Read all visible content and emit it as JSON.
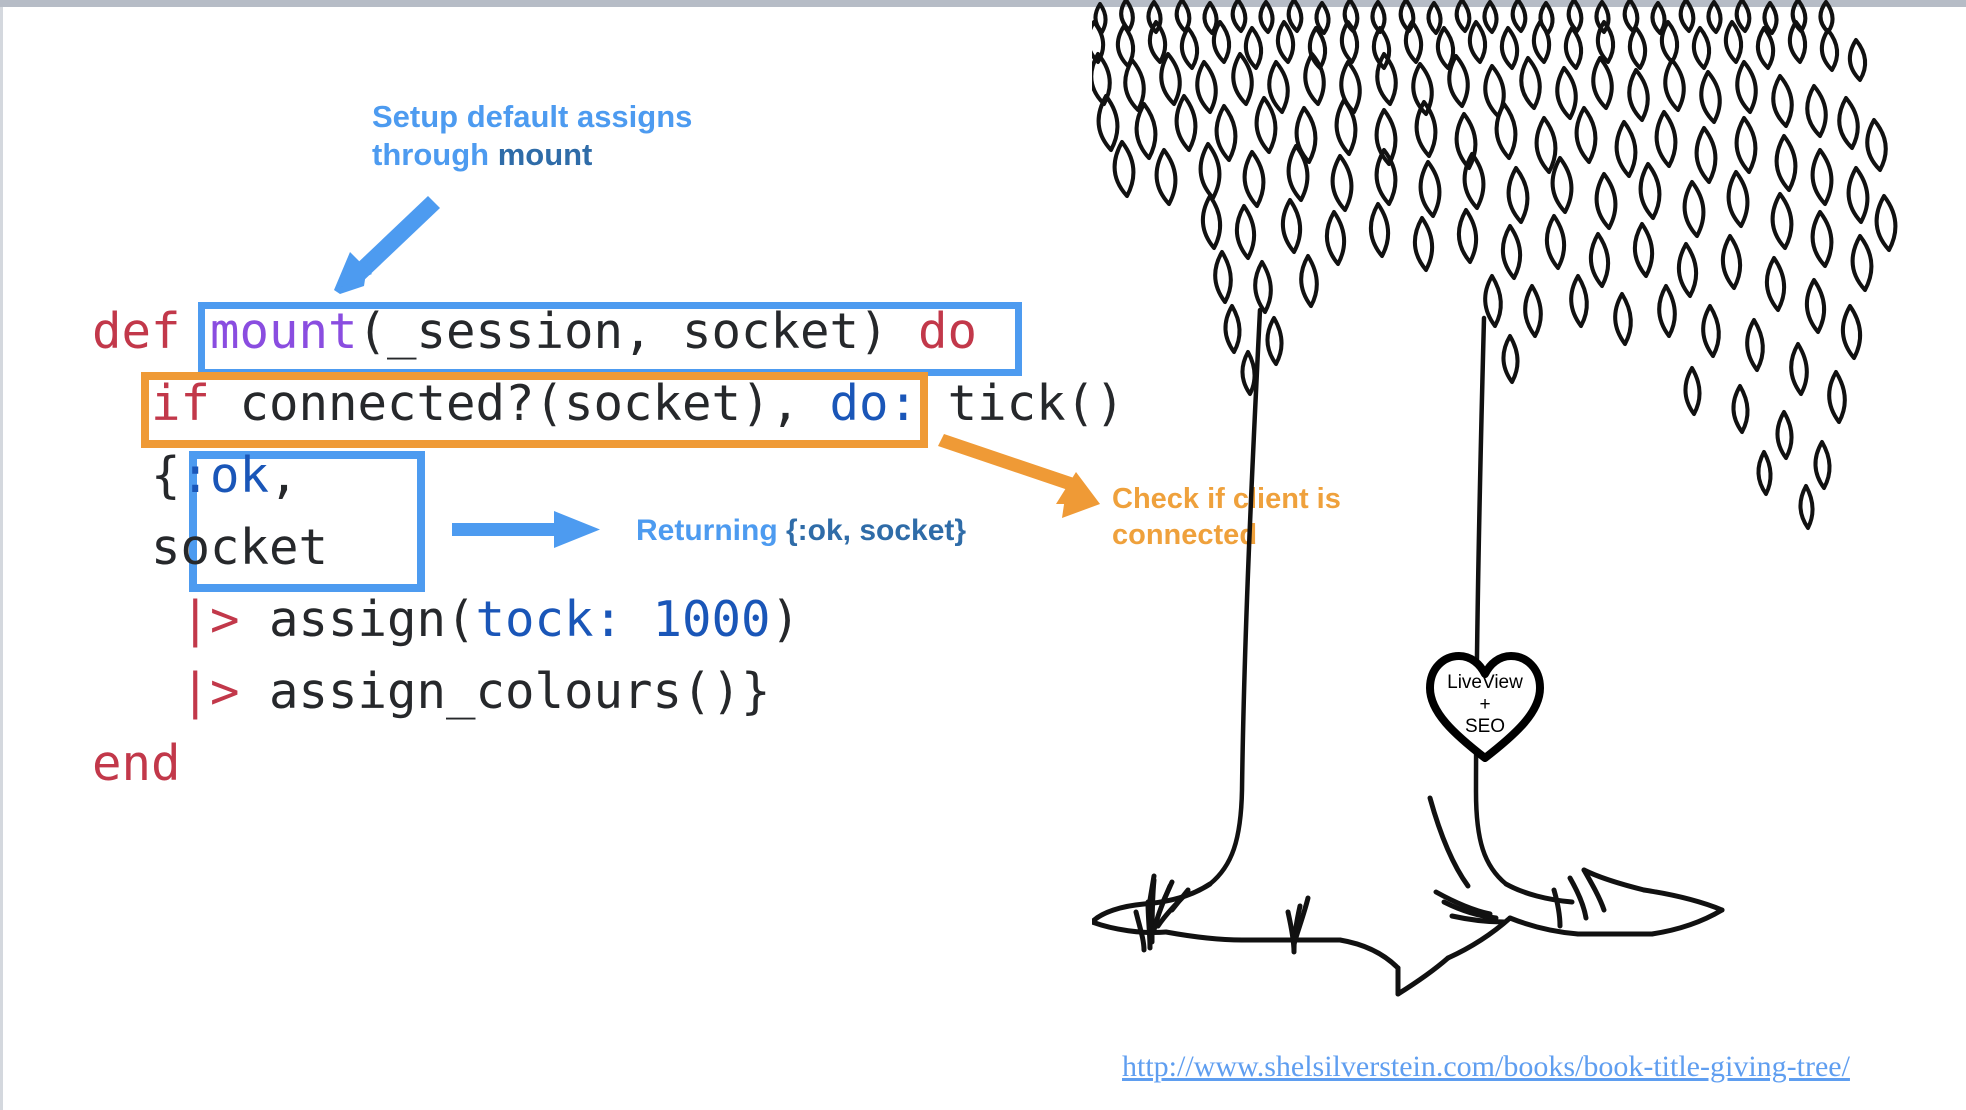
{
  "slide": {
    "background_color": "#ffffff"
  },
  "code": {
    "language": "elixir",
    "font": "monospace",
    "lines": [
      {
        "id": "line-def",
        "tokens": [
          {
            "text": "def ",
            "style": "red"
          },
          {
            "text": "mount",
            "style": "purple"
          },
          {
            "text": "(_session, socket) ",
            "style": "plain"
          },
          {
            "text": "do",
            "style": "red"
          }
        ]
      },
      {
        "id": "line-if",
        "tokens": [
          {
            "text": "  ",
            "style": "plain"
          },
          {
            "text": "if",
            "style": "red"
          },
          {
            "text": " connected?(socket), ",
            "style": "plain"
          },
          {
            "text": "do:",
            "style": "blue"
          },
          {
            "text": " tick()",
            "style": "plain"
          }
        ]
      },
      {
        "id": "line-ok",
        "tokens": [
          {
            "text": "  {",
            "style": "plain"
          },
          {
            "text": ":ok",
            "style": "blue"
          },
          {
            "text": ",",
            "style": "plain"
          }
        ]
      },
      {
        "id": "line-socket",
        "tokens": [
          {
            "text": "  socket",
            "style": "plain"
          }
        ]
      },
      {
        "id": "line-assign-tock",
        "tokens": [
          {
            "text": "   ",
            "style": "plain"
          },
          {
            "text": "|>",
            "style": "red"
          },
          {
            "text": " assign(",
            "style": "plain"
          },
          {
            "text": "tock: 1000",
            "style": "blue"
          },
          {
            "text": ")",
            "style": "plain"
          }
        ]
      },
      {
        "id": "line-assign-colours",
        "tokens": [
          {
            "text": "   ",
            "style": "plain"
          },
          {
            "text": "|>",
            "style": "red"
          },
          {
            "text": " assign_colours()}",
            "style": "plain"
          }
        ]
      },
      {
        "id": "line-end",
        "tokens": [
          {
            "text": "end",
            "style": "red"
          }
        ]
      }
    ]
  },
  "annotations": {
    "mount": {
      "text_plain": "Setup default assigns\nthrough ",
      "text_keyword": "mount",
      "color": "#4d9bf0",
      "keyword_color": "#2f6ca8"
    },
    "returning": {
      "text_plain": "Returning ",
      "text_keyword": "{:ok, socket}",
      "color": "#4d9bf0",
      "keyword_color": "#2f6ca8"
    },
    "connected": {
      "text": "Check if client is connected",
      "color": "#efa13c"
    }
  },
  "highlight_boxes": [
    {
      "id": "box-mount",
      "target": "mount(_session, socket)",
      "color": "#4d9bf0"
    },
    {
      "id": "box-if",
      "target": "if connected?(socket),",
      "color": "#ef9a36"
    },
    {
      "id": "box-ok",
      "target": "{:ok, socket",
      "color": "#4d9bf0"
    }
  ],
  "illustration": {
    "name": "giving-tree-line-art",
    "heart": {
      "line1": "LiveView",
      "line2": "+",
      "line3": "SEO"
    }
  },
  "source_link": {
    "label": "http://www.shelsilverstein.com/books/book-title-giving-tree/",
    "color": "#5f9ef0"
  }
}
